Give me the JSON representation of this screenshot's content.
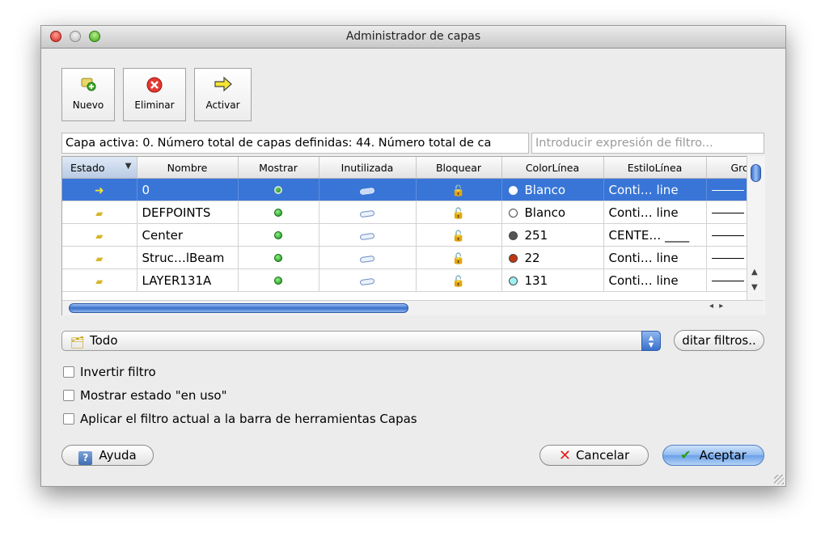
{
  "window": {
    "title": "Administrador de capas"
  },
  "toolbar": {
    "new_label": "Nuevo",
    "delete_label": "Eliminar",
    "activate_label": "Activar"
  },
  "status_text": "Capa activa: 0. Número total de capas definidas: 44. Número total de ca",
  "filter_placeholder": "Introducir expresión de filtro...",
  "table": {
    "columns": [
      "Estado",
      "Nombre",
      "Mostrar",
      "Inutilizada",
      "Bloquear",
      "ColorLínea",
      "EstiloLínea",
      "Grc"
    ],
    "rows": [
      {
        "name": "0",
        "color_name": "Blanco",
        "color_hex": "#ffffff",
        "linestyle": "Conti… line",
        "selected": true
      },
      {
        "name": "DEFPOINTS",
        "color_name": "Blanco",
        "color_hex": "#ffffff",
        "linestyle": "Conti… line",
        "selected": false
      },
      {
        "name": "Center",
        "color_name": "251",
        "color_hex": "#555555",
        "linestyle": "CENTE… ____",
        "selected": false
      },
      {
        "name": "Struc…lBeam",
        "color_name": "22",
        "color_hex": "#c0370f",
        "linestyle": "Conti… line",
        "selected": false
      },
      {
        "name": "LAYER131A",
        "color_name": "131",
        "color_hex": "#9ff2f4",
        "linestyle": "Conti… line",
        "selected": false
      }
    ]
  },
  "filter_combo": {
    "value": "Todo"
  },
  "edit_filters_label": "ditar filtros..",
  "options": {
    "invert": "Invertir filtro",
    "show_in_use": "Mostrar estado \"en uso\"",
    "apply_toolbar": "Aplicar el filtro actual a la barra de herramientas Capas"
  },
  "buttons": {
    "help": "Ayuda",
    "cancel": "Cancelar",
    "accept": "Aceptar"
  },
  "colors": {
    "selection": "#3875d7",
    "accent": "#3a70cc"
  }
}
